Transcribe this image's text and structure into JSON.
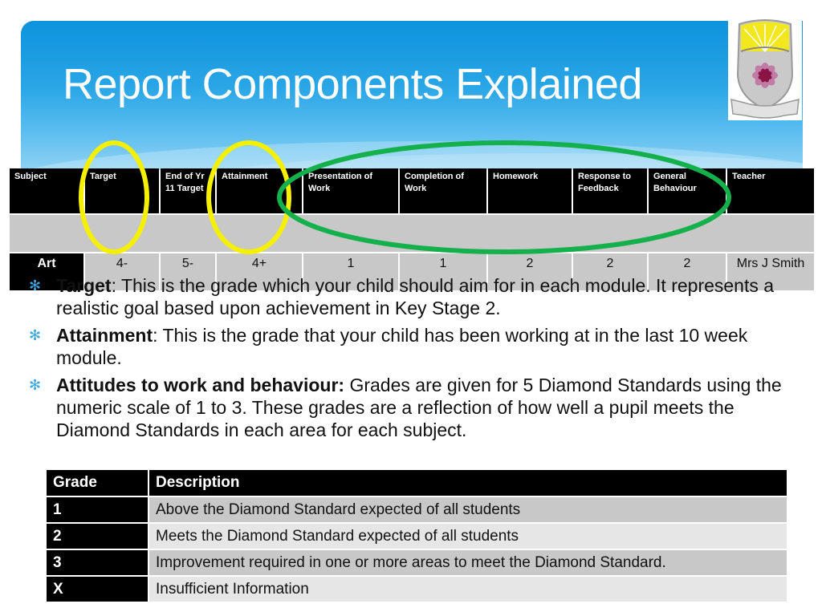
{
  "slide": {
    "title": "Report Components Explained",
    "logo": "school-crest-logo"
  },
  "report_table": {
    "headers": [
      "Subject",
      "Target",
      "End of Yr 11 Target",
      "Attainment",
      "Presentation of Work",
      "Completion of Work",
      "Homework",
      "Response to Feedback",
      "General Behaviour",
      "Teacher"
    ],
    "row": [
      "Art",
      "4-",
      "5-",
      "4+",
      "1",
      "1",
      "2",
      "2",
      "2",
      "Mrs J Smith"
    ]
  },
  "annotations": {
    "yellow_circles": [
      "Target",
      "Attainment"
    ],
    "green_oval": [
      "Presentation of Work",
      "Completion of Work",
      "Homework",
      "Response to Feedback",
      "General Behaviour"
    ],
    "yellow_color": "#f5f000",
    "green_color": "#13b04b"
  },
  "bullets": [
    {
      "term": "Target",
      "sep": ": ",
      "text": "This is the grade which your child should aim for in each module. It represents a realistic goal based upon achievement in Key Stage 2."
    },
    {
      "term": "Attainment",
      "sep": ": ",
      "text": "This is the grade that your child has been working at in the last 10 week module."
    },
    {
      "term": "Attitudes to work and behaviour:",
      "sep": " ",
      "text": "Grades are given for 5 Diamond Standards using the numeric scale of 1 to 3.  These grades are a reflection of how well a pupil meets the Diamond Standards in each area for each subject."
    }
  ],
  "grades_table": {
    "headers": [
      "Grade",
      "Description"
    ],
    "rows": [
      {
        "grade": "1",
        "description": "Above the Diamond Standard expected of all students"
      },
      {
        "grade": "2",
        "description": "Meets the Diamond Standard expected of all students"
      },
      {
        "grade": "3",
        "description": "Improvement required in one or more areas to meet the Diamond Standard."
      },
      {
        "grade": "X",
        "description": "Insufficient Information"
      }
    ]
  },
  "colors": {
    "banner_blue": "#0d93dd",
    "bullet_star": "#3aa7de"
  }
}
